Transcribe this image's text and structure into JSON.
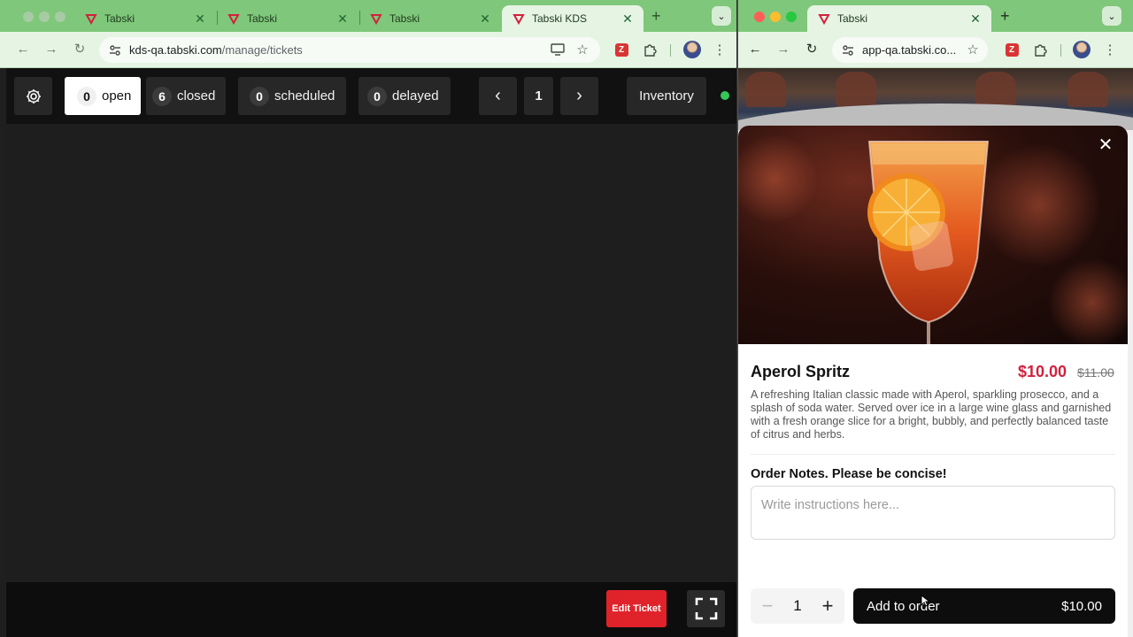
{
  "left_window": {
    "tabs": [
      {
        "title": "Tabski"
      },
      {
        "title": "Tabski"
      },
      {
        "title": "Tabski"
      },
      {
        "title": "Tabski KDS"
      }
    ],
    "url_host": "kds-qa.tabski.com",
    "url_path": "/manage/tickets"
  },
  "kds": {
    "filters": [
      {
        "count": "0",
        "label": "open"
      },
      {
        "count": "6",
        "label": "closed"
      },
      {
        "count": "0",
        "label": "scheduled"
      },
      {
        "count": "0",
        "label": "delayed"
      }
    ],
    "page_number": "1",
    "inventory_label": "Inventory",
    "status_color": "#34c759",
    "edit_ticket_label": "Edit Ticket"
  },
  "right_window": {
    "tab_title": "Tabski",
    "url": "app-qa.tabski.co..."
  },
  "item": {
    "name": "Aperol Spritz",
    "price": "$10.00",
    "original_price": "$11.00",
    "description": "A refreshing Italian classic made with Aperol, sparkling prosecco, and a splash of soda water. Served over ice in a large wine glass and garnished with a fresh orange slice for a bright, bubbly, and perfectly balanced taste of citrus and herbs.",
    "notes_label": "Order Notes. Please be concise!",
    "notes_placeholder": "Write instructions here...",
    "quantity": "1",
    "add_label": "Add to order",
    "add_total": "$10.00"
  },
  "colors": {
    "tabstrip": "#7fc77a",
    "price_red": "#d1213d",
    "edit_ticket_red": "#e0232b"
  }
}
